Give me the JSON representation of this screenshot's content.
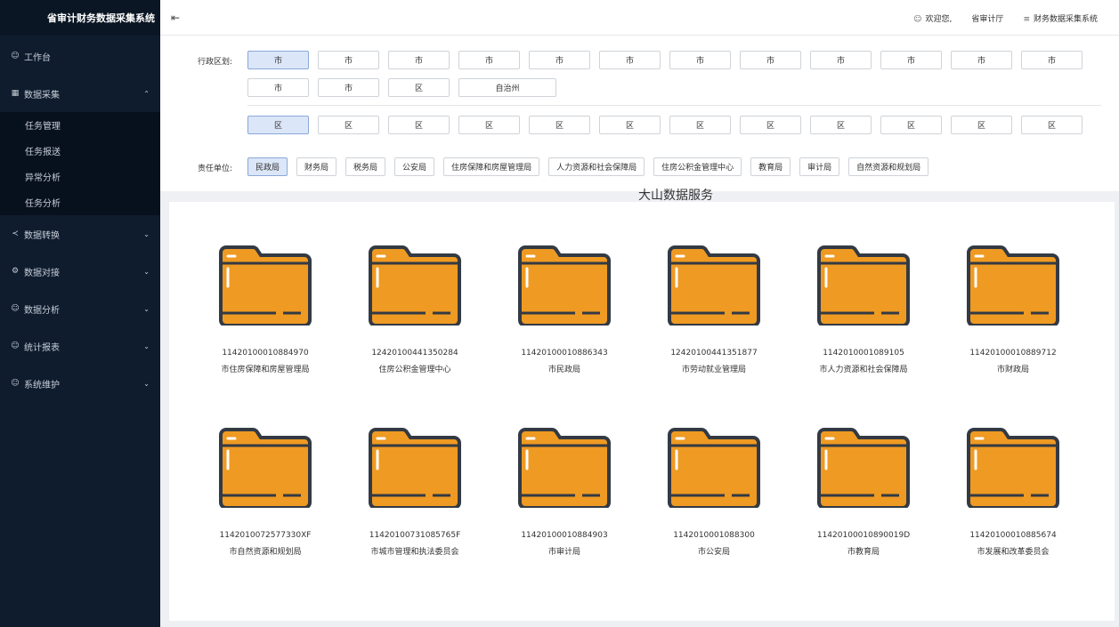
{
  "app": {
    "title": "省审计财务数据采集系统"
  },
  "header": {
    "user_greeting": "欢迎您,",
    "org": "省审计厅",
    "system": "财务数据采集系统"
  },
  "sidebar": {
    "items": [
      {
        "label": "工作台",
        "icon": "user-icon",
        "chevron": ""
      },
      {
        "label": "数据采集",
        "icon": "grid-icon",
        "chevron": "up"
      },
      {
        "label": "数据转换",
        "icon": "share-icon",
        "chevron": "down"
      },
      {
        "label": "数据对接",
        "icon": "settings-icon",
        "chevron": "down"
      },
      {
        "label": "数据分析",
        "icon": "user-icon",
        "chevron": "down"
      },
      {
        "label": "统计报表",
        "icon": "user-icon",
        "chevron": "down"
      },
      {
        "label": "系统维护",
        "icon": "user-icon",
        "chevron": "down"
      }
    ],
    "subitems": [
      "任务管理",
      "任务报送",
      "异常分析",
      "任务分析"
    ]
  },
  "filters": {
    "region_label": "行政区划:",
    "region_row1": [
      "市",
      "市",
      "市",
      "市",
      "市",
      "市",
      "市",
      "市",
      "市",
      "市",
      "市",
      "市"
    ],
    "region_row2": [
      "市",
      "市",
      "区",
      "自治州"
    ],
    "district_row": [
      "区",
      "区",
      "区",
      "区",
      "区",
      "区",
      "区",
      "区",
      "区",
      "区",
      "区",
      "区"
    ],
    "org_label": "责任单位:",
    "orgs": [
      "民政局",
      "财务局",
      "税务局",
      "公安局",
      "住房保障和房屋管理局",
      "人力资源和社会保障局",
      "住房公积金管理中心",
      "教育局",
      "审计局",
      "自然资源和规划局"
    ]
  },
  "watermark": "大山数据服务",
  "folders": [
    {
      "code": "11420100010884970",
      "name": "市住房保障和房屋管理局"
    },
    {
      "code": "12420100441350284",
      "name": "住房公积金管理中心"
    },
    {
      "code": "11420100010886343",
      "name": "市民政局"
    },
    {
      "code": "12420100441351877",
      "name": "市劳动就业管理局"
    },
    {
      "code": "1142010001089105",
      "name": "市人力资源和社会保障局"
    },
    {
      "code": "11420100010889712",
      "name": "市财政局"
    },
    {
      "code": "1142010072577330XF",
      "name": "市自然资源和规划局"
    },
    {
      "code": "11420100731085765F",
      "name": "市城市管理和执法委员会"
    },
    {
      "code": "11420100010884903",
      "name": "市审计局"
    },
    {
      "code": "1142010001088300",
      "name": "市公安局"
    },
    {
      "code": "11420100010890019D",
      "name": "市教育局"
    },
    {
      "code": "11420100010885674",
      "name": "市发展和改革委员会"
    }
  ],
  "colors": {
    "sidebar_bg": "#0f1c2e",
    "folder_fill": "#ef9a22",
    "folder_stroke": "#333a44",
    "active_btn": "#dbe6f8"
  }
}
